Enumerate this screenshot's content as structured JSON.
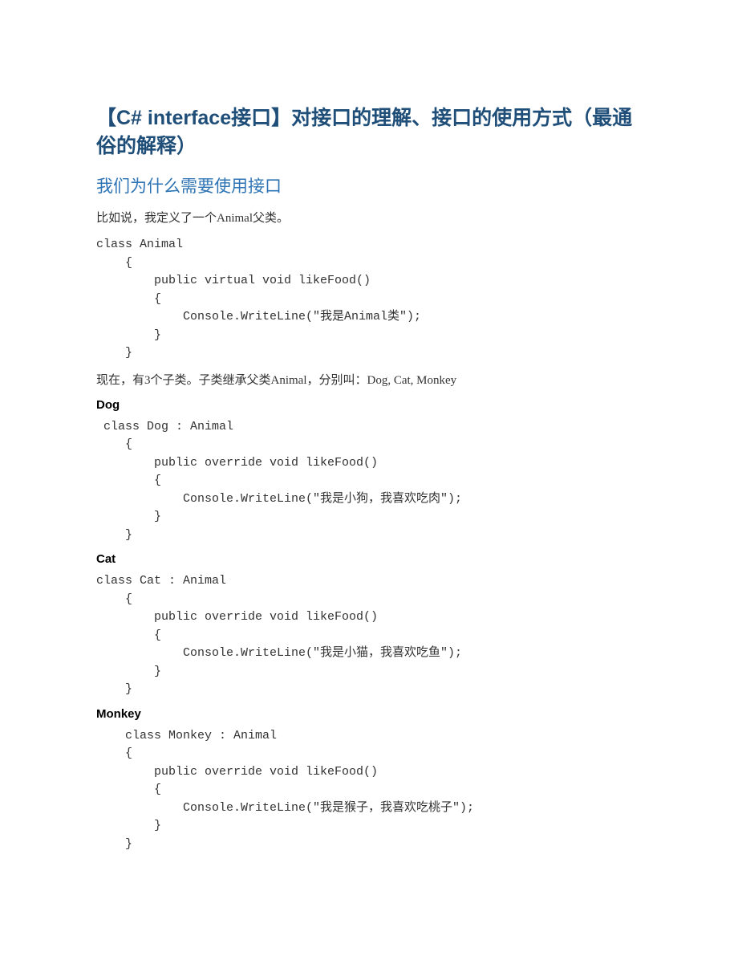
{
  "title": "【C#\ninterface接口】对接口的理解、接口的使用方式（最通俗的解释）",
  "subtitle": "我们为什么需要使用接口",
  "intro_text": "比如说，我定义了一个Animal父类。",
  "code_animal": "class Animal\n    {\n        public virtual void likeFood()\n        {\n            Console.WriteLine(\"我是Animal类\");\n        }\n    }",
  "children_text": "现在，有3个子类。子类继承父类Animal，分别叫：Dog, Cat, Monkey",
  "sections": {
    "dog": {
      "label": "Dog",
      "code": " class Dog : Animal\n    {\n        public override void likeFood()\n        {\n            Console.WriteLine(\"我是小狗，我喜欢吃肉\");\n        }\n    }"
    },
    "cat": {
      "label": "Cat",
      "code": "class Cat : Animal\n    {\n        public override void likeFood()\n        {\n            Console.WriteLine(\"我是小猫，我喜欢吃鱼\");\n        }\n    }"
    },
    "monkey": {
      "label": "Monkey",
      "code": "    class Monkey : Animal\n    {\n        public override void likeFood()\n        {\n            Console.WriteLine(\"我是猴子，我喜欢吃桃子\");\n        }\n    }"
    }
  }
}
